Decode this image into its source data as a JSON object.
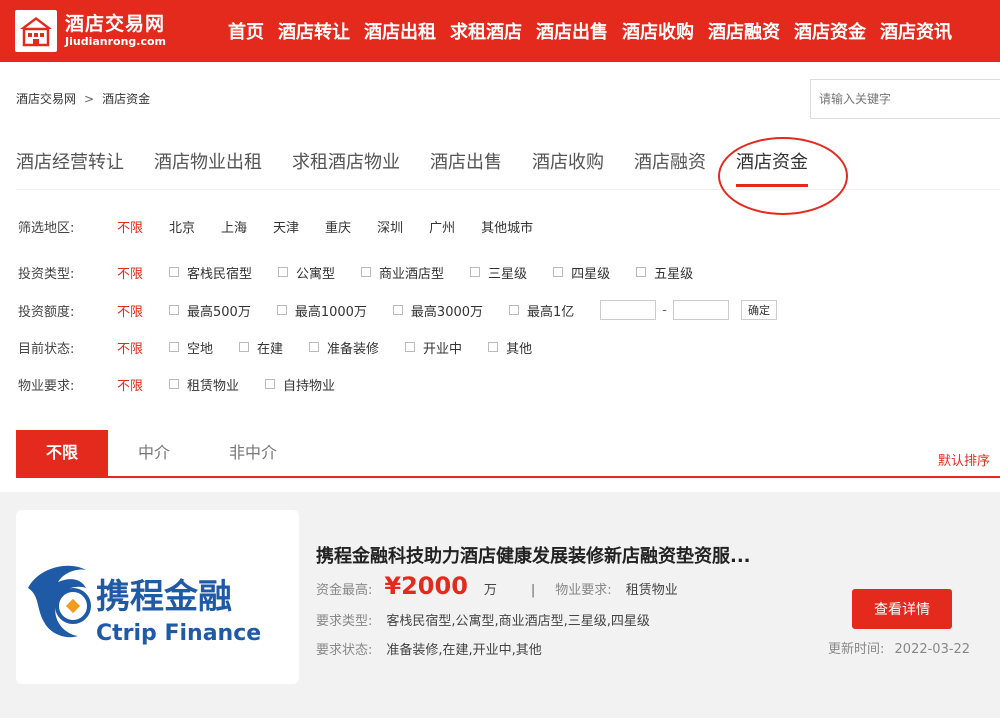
{
  "header": {
    "logo_cn": "酒店交易网",
    "logo_en": "Jiudianrong.com",
    "nav": [
      "首页",
      "酒店转让",
      "酒店出租",
      "求租酒店",
      "酒店出售",
      "酒店收购",
      "酒店融资",
      "酒店资金",
      "酒店资讯"
    ]
  },
  "breadcrumb": {
    "home": "酒店交易网",
    "sep": ">",
    "current": "酒店资金"
  },
  "search": {
    "placeholder": "请输入关键字"
  },
  "category_tabs": [
    "酒店经营转让",
    "酒店物业出租",
    "求租酒店物业",
    "酒店出售",
    "酒店收购",
    "酒店融资",
    "酒店资金"
  ],
  "active_category": "酒店资金",
  "filters": {
    "region": {
      "label": "筛选地区:",
      "all": "不限",
      "options": [
        "北京",
        "上海",
        "天津",
        "重庆",
        "深圳",
        "广州",
        "其他城市"
      ]
    },
    "invest_type": {
      "label": "投资类型:",
      "all": "不限",
      "options": [
        "客栈民宿型",
        "公寓型",
        "商业酒店型",
        "三星级",
        "四星级",
        "五星级"
      ]
    },
    "amount": {
      "label": "投资额度:",
      "all": "不限",
      "options": [
        "最高500万",
        "最高1000万",
        "最高3000万",
        "最高1亿"
      ],
      "range_dash": "-",
      "confirm": "确定"
    },
    "status": {
      "label": "目前状态:",
      "all": "不限",
      "options": [
        "空地",
        "在建",
        "准备装修",
        "开业中",
        "其他"
      ]
    },
    "property": {
      "label": "物业要求:",
      "all": "不限",
      "options": [
        "租赁物业",
        "自持物业"
      ]
    }
  },
  "list_tabs": [
    "不限",
    "中介",
    "非中介"
  ],
  "sort_label": "默认排序",
  "listing": {
    "title": "携程金融科技助力酒店健康发展装修新店融资垫资服...",
    "amount_label": "资金最高:",
    "amount": "¥2000",
    "unit": "万",
    "bar": "|",
    "property_label": "物业要求:",
    "property_value": "租赁物业",
    "type_label": "要求类型:",
    "type_value": "客栈民宿型,公寓型,商业酒店型,三星级,四星级",
    "status_label": "要求状态:",
    "status_value": "准备装修,在建,开业中,其他",
    "button": "查看详情",
    "updated_label": "更新时间:",
    "updated_value": "2022-03-22",
    "logo_cn": "携程金融",
    "logo_en": "Ctrip Finance"
  },
  "colors": {
    "brand": "#e42a1d",
    "logo_blue": "#1f5aa6"
  }
}
